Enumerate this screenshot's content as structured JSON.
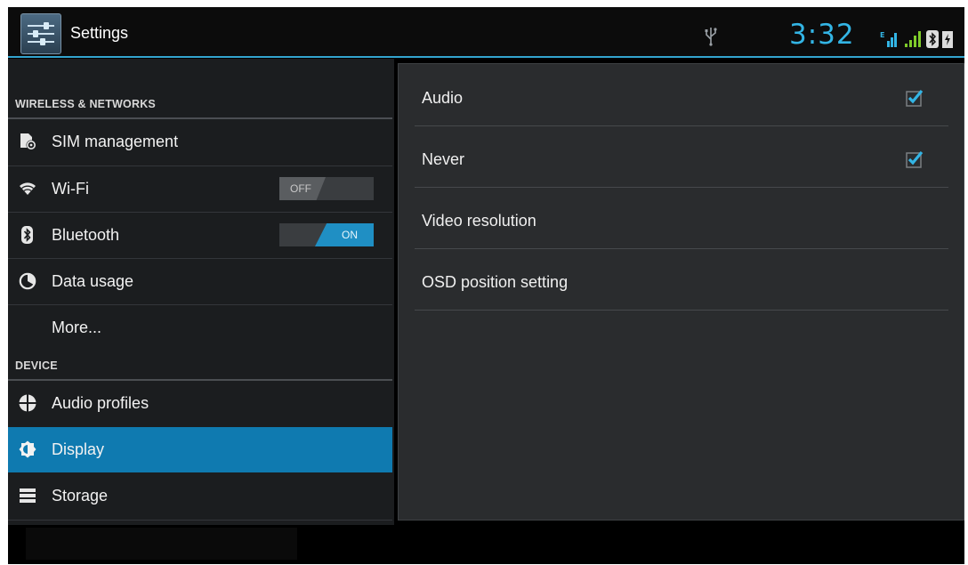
{
  "status_bar": {
    "app_title": "Settings",
    "clock": "3:32",
    "icons": [
      "usb-icon",
      "signal-e-icon",
      "signal-icon",
      "bluetooth-icon",
      "battery-charging-icon"
    ],
    "accent_color": "#33b5e5"
  },
  "sidebar": {
    "sections": [
      {
        "header": "WIRELESS & NETWORKS"
      },
      {
        "header": "DEVICE"
      }
    ],
    "items": [
      {
        "label": "SIM management",
        "icon": "sim-icon"
      },
      {
        "label": "Wi-Fi",
        "icon": "wifi-icon",
        "toggle": "OFF"
      },
      {
        "label": "Bluetooth",
        "icon": "bluetooth-icon",
        "toggle": "ON"
      },
      {
        "label": "Data usage",
        "icon": "data-usage-icon"
      },
      {
        "label": "More..."
      },
      {
        "label": "Audio profiles",
        "icon": "audio-profiles-icon"
      },
      {
        "label": "Display",
        "icon": "display-icon",
        "selected": true
      },
      {
        "label": "Storage",
        "icon": "storage-icon"
      }
    ],
    "selected_color": "#0f7ab0"
  },
  "detail": {
    "prefs": [
      {
        "title": "Audio",
        "checked": true
      },
      {
        "title": "Never",
        "checked": true
      },
      {
        "title": "Video resolution"
      },
      {
        "title": "OSD position setting"
      }
    ]
  }
}
